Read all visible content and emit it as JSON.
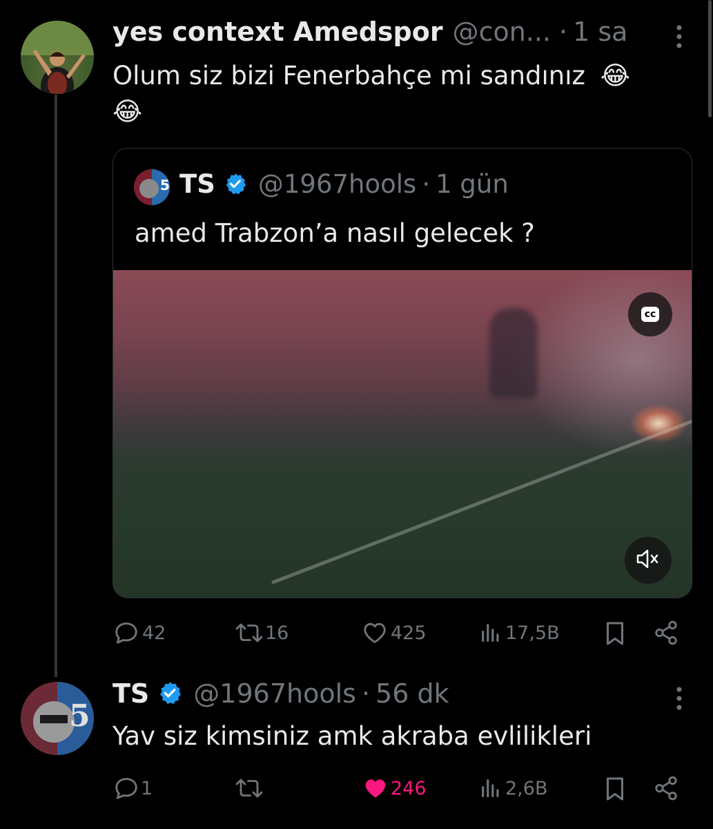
{
  "post": {
    "author_name": "yes context Amedspor",
    "handle": "@con...",
    "separator": "·",
    "time": "1 sa",
    "text": "Olum siz bizi Fenerbahçe mi sandınız",
    "emoji": "😂",
    "more_icon": "more-vertical-icon",
    "quote": {
      "author_name": "TS",
      "handle": "@1967hools",
      "separator": "·",
      "time": "1 gün",
      "text": "amed Trabzon’a nasıl gelecek ?",
      "cc_label": "cc",
      "mute_icon": "speaker-muted-icon"
    },
    "actions": {
      "replies": "42",
      "reposts": "16",
      "likes": "425",
      "views": "17,5B"
    }
  },
  "reply": {
    "author_name": "TS",
    "handle": "@1967hools",
    "separator": "·",
    "time": "56 dk",
    "text": "Yav siz kimsiniz amk akraba evlilikleri",
    "more_icon": "more-vertical-icon",
    "actions": {
      "replies": "1",
      "reposts": "",
      "likes": "246",
      "views": "2,6B"
    }
  },
  "colors": {
    "background": "#000000",
    "text": "#e7e9ea",
    "muted": "#71767b",
    "verified": "#1d9bf0",
    "liked": "#f91880",
    "border": "#2f3336"
  }
}
